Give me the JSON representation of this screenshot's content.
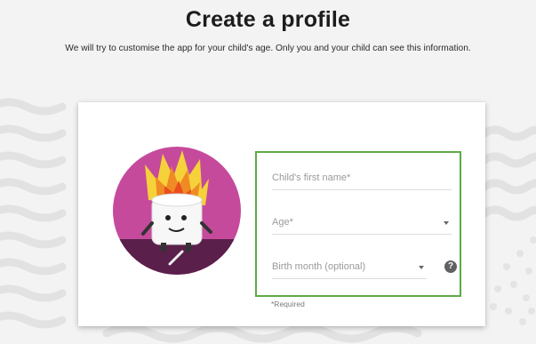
{
  "page": {
    "title": "Create a profile",
    "subtitle": "We will try to customise the app for your child's age. Only you and your child can see this information."
  },
  "form": {
    "first_name_placeholder": "Child's first name*",
    "age_placeholder": "Age*",
    "birth_month_placeholder": "Birth month (optional)",
    "help_icon_glyph": "?",
    "required_note": "*Required"
  },
  "icons": {
    "avatar": "marshmallow-fire-avatar",
    "help": "help-icon",
    "dropdown": "chevron-down-icon"
  },
  "colors": {
    "background": "#f3f3f3",
    "card": "#ffffff",
    "highlight_border": "#5eaa46",
    "avatar_bg": "#c64a9c",
    "avatar_ground": "#5a1f4a"
  }
}
